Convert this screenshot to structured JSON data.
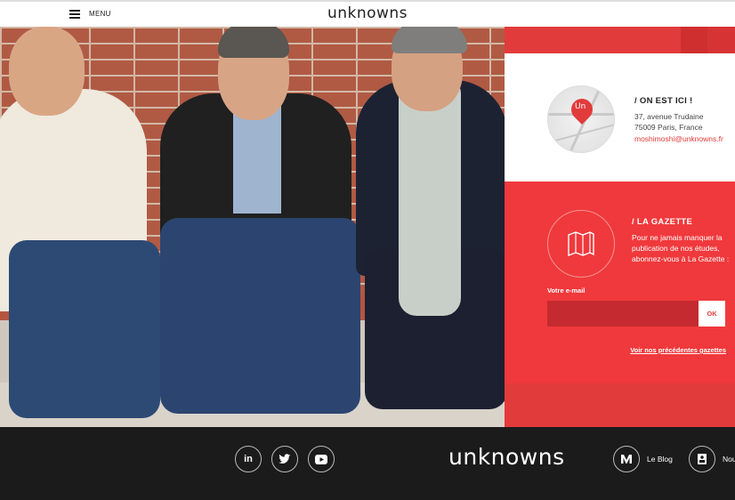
{
  "header": {
    "menu_label": "MENU",
    "logo": "unknowns"
  },
  "location": {
    "title": "/  ON EST ICI !",
    "street": "37, avenue Trudaine",
    "city": "75009 Paris, France",
    "email": "moshimoshi@unknowns.fr",
    "pin_glyph": "Un"
  },
  "gazette": {
    "title": "/  LA GAZETTE",
    "text": "Pour ne jamais manquer la publication de nos études, abonnez-vous à La Gazette :",
    "email_label": "Votre e-mail",
    "email_value": "",
    "ok_label": "OK",
    "previous_link": "Voir nos précédentes gazettes"
  },
  "footer": {
    "logo": "unknowns",
    "social": [
      {
        "icon": "linkedin-icon",
        "glyph": "in"
      },
      {
        "icon": "twitter-icon",
        "glyph": "🐦"
      },
      {
        "icon": "youtube-icon",
        "glyph": "▶"
      }
    ],
    "links": [
      {
        "label": "Le Blog",
        "icon": "medium-icon"
      },
      {
        "label": "Nous",
        "icon": "contact-card-icon"
      }
    ]
  },
  "colors": {
    "accent": "#e23b3b",
    "footer_bg": "#1b1b1b"
  }
}
